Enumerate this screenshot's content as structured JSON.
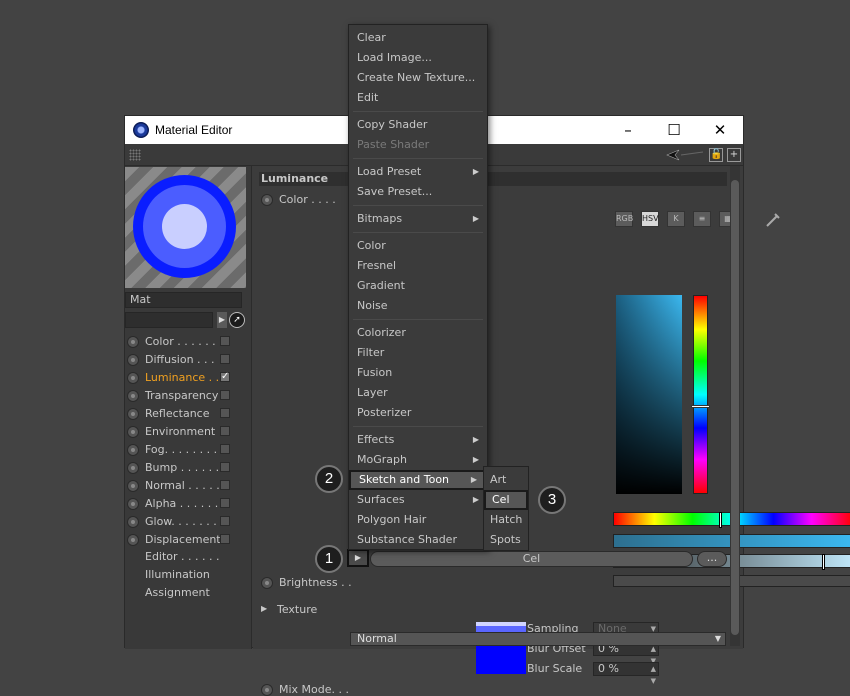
{
  "window": {
    "title": "Material Editor",
    "controls": {
      "minimize": "–",
      "maximize": "☐",
      "close": "✕"
    }
  },
  "material": {
    "name": "Mat"
  },
  "channels": [
    {
      "label": "Color . . . . . .",
      "checked": false
    },
    {
      "label": "Diffusion . . .",
      "checked": false
    },
    {
      "label": "Luminance . .",
      "checked": true,
      "active": true
    },
    {
      "label": "Transparency",
      "checked": false
    },
    {
      "label": "Reflectance",
      "checked": false
    },
    {
      "label": "Environment",
      "checked": false
    },
    {
      "label": "Fog. . . . . . . .",
      "checked": false
    },
    {
      "label": "Bump . . . . . .",
      "checked": false
    },
    {
      "label": "Normal . . . . .",
      "checked": false
    },
    {
      "label": "Alpha . . . . . .",
      "checked": false
    },
    {
      "label": "Glow. . . . . . .",
      "checked": false
    },
    {
      "label": "Displacement",
      "checked": false
    }
  ],
  "extra_items": [
    "Editor . . . . . .",
    "Illumination",
    "Assignment"
  ],
  "panel": {
    "section": "Luminance",
    "color_label": "Color . . . .",
    "brightness_label": "Brightness . .",
    "texture_label": "Texture",
    "texture_value": "Cel",
    "texture_more": "...",
    "color_modes": [
      "RGB",
      "HSV",
      "K"
    ],
    "sampling_label": "Sampling",
    "sampling_value": "None",
    "blur_offset_label": "Blur Offset",
    "blur_offset_value": "0 %",
    "blur_scale_label": "Blur Scale",
    "blur_scale_value": "0 %",
    "mix_mode_label": "Mix Mode. . .",
    "mix_mode_value": "Normal"
  },
  "menu": {
    "groups": [
      [
        "Clear",
        "Load Image...",
        "Create New Texture...",
        "Edit"
      ],
      [
        "Copy Shader",
        "Paste Shader"
      ],
      [
        "Load Preset",
        "Save Preset..."
      ],
      [
        "Bitmaps"
      ],
      [
        "Color",
        "Fresnel",
        "Gradient",
        "Noise"
      ],
      [
        "Colorizer",
        "Filter",
        "Fusion",
        "Layer",
        "Posterizer"
      ],
      [
        "Effects",
        "MoGraph",
        "Sketch and Toon",
        "Surfaces",
        "Polygon Hair",
        "Substance Shader"
      ]
    ]
  },
  "submenu": [
    "Art",
    "Cel",
    "Hatch",
    "Spots"
  ],
  "badges": [
    "1",
    "2",
    "3"
  ],
  "colors": {
    "accent": "#f0a020",
    "ball_outer": "#0a1dff",
    "ball_ring": "#4b5dff",
    "ball_core": "#c9cfff"
  }
}
